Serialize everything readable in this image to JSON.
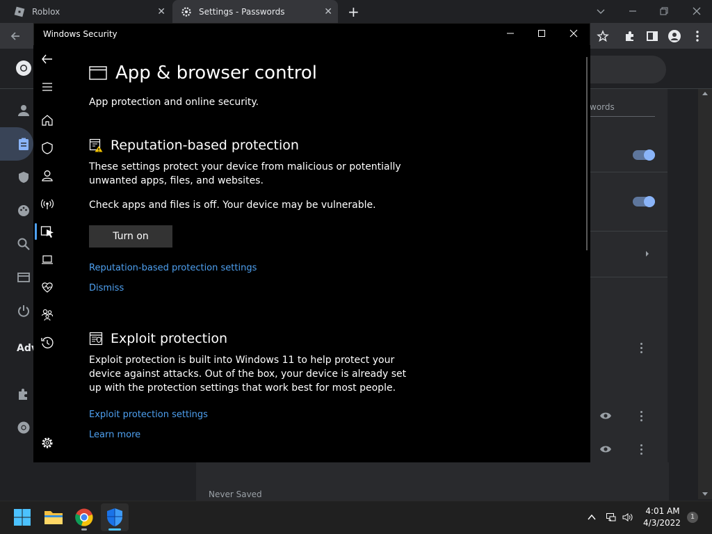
{
  "browser": {
    "tabs": [
      {
        "label": "Roblox",
        "active": false
      },
      {
        "label": "Settings - Passwords",
        "active": true
      }
    ],
    "new_tab": "+",
    "tab_close": "✕"
  },
  "chrome_settings": {
    "advanced_label": "Adv",
    "passwords_tab": "words",
    "never_saved": "Never Saved"
  },
  "window": {
    "title": "Windows Security"
  },
  "page": {
    "title": "App & browser control",
    "subtitle": "App protection and online security."
  },
  "reputation": {
    "title": "Reputation-based protection",
    "description": "These settings protect your device from malicious or potentially unwanted apps, files, and websites.",
    "warning": "Check apps and files is off. Your device may be vulnerable.",
    "button": "Turn on",
    "settings_link": "Reputation-based protection settings",
    "dismiss_link": "Dismiss"
  },
  "exploit": {
    "title": "Exploit protection",
    "description": "Exploit protection is built into Windows 11 to help protect your device against attacks.  Out of the box, your device is already set up with the protection settings that work best for most people.",
    "settings_link": "Exploit protection settings",
    "learn_more": "Learn more"
  },
  "taskbar": {
    "time": "4:01 AM",
    "date": "4/3/2022",
    "notifications": "1"
  },
  "colors": {
    "accent_link": "#4ea0f0",
    "chrome_toggle": "#8ab4f8"
  }
}
